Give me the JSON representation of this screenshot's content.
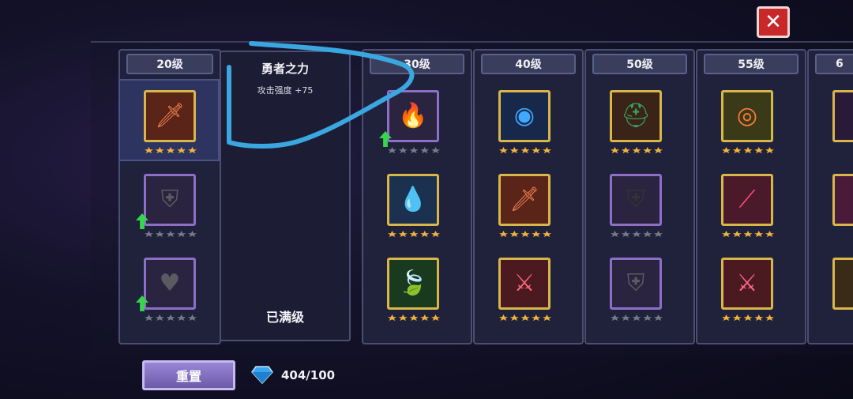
{
  "close": {
    "label": "✕"
  },
  "columns": [
    {
      "level": "20级"
    },
    {
      "level": "30级"
    },
    {
      "level": "40级"
    },
    {
      "level": "50级"
    },
    {
      "level": "55级"
    },
    {
      "level": "6"
    }
  ],
  "info": {
    "title": "勇者之力",
    "description": "攻击强度 +75",
    "status": "已满级"
  },
  "footer": {
    "reset_label": "重置",
    "gems": "404/100"
  },
  "colors": {
    "gold_frame": "#d8b64a",
    "locked_frame": "#8e6fc8",
    "close_red": "#c8282a",
    "annotation_blue": "#3aa7e0"
  },
  "icons": [
    "sword-icon",
    "armor-icon",
    "heart-icon",
    "flame-icon",
    "water-drop-icon",
    "leaf-icon",
    "blue-orb-icon",
    "dagger-icon",
    "crystal-sword-icon",
    "green-helmet-icon",
    "dark-armor-icon",
    "eye-icon",
    "slash-icon",
    "diamond-gem-icon"
  ]
}
